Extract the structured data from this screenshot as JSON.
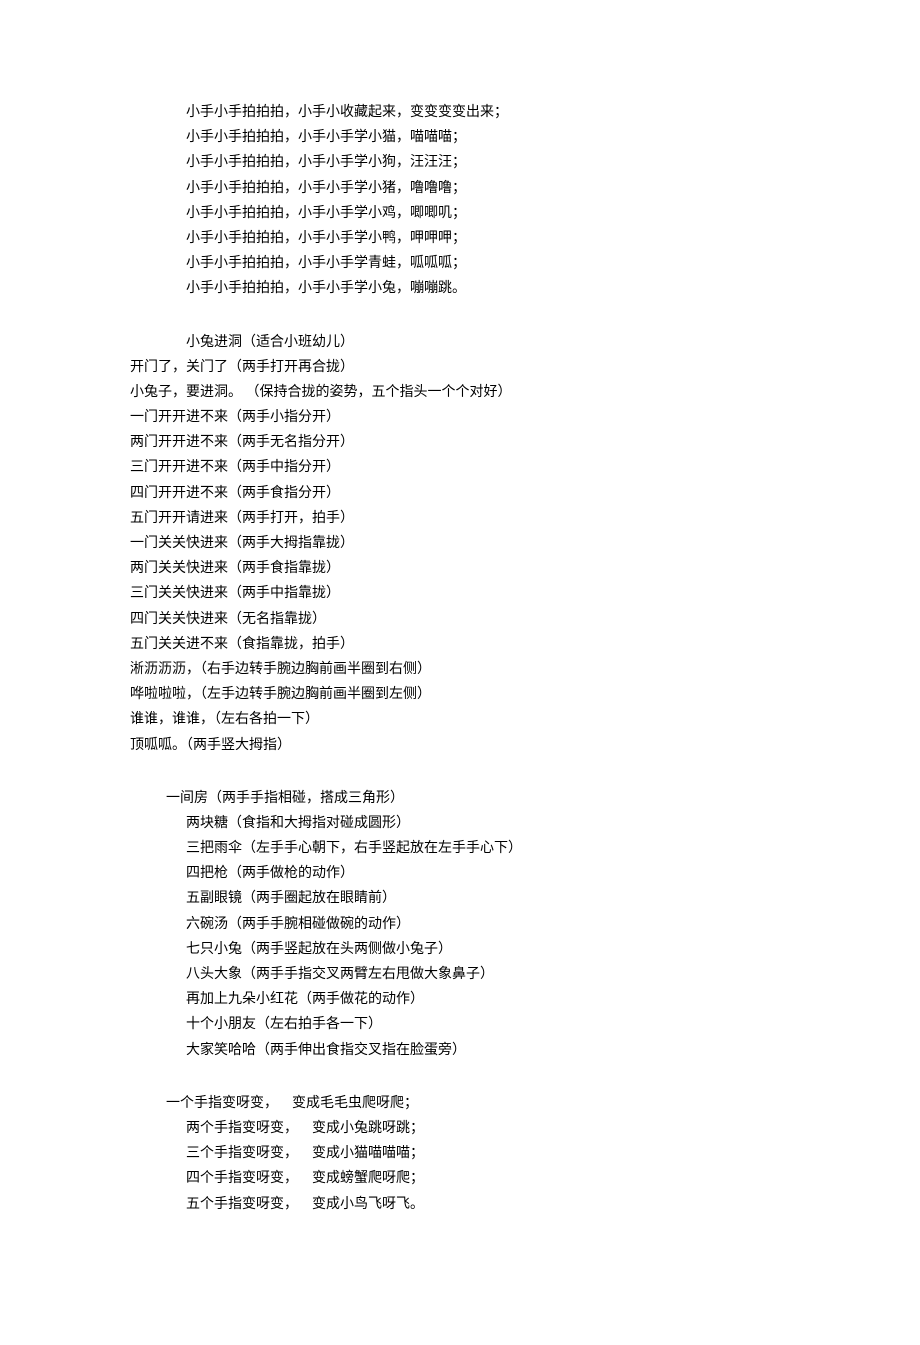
{
  "section1": {
    "lines": [
      "小手小手拍拍拍，小手小收藏起来，变变变变出来；",
      "小手小手拍拍拍，小手小手学小猫，喵喵喵；",
      "小手小手拍拍拍，小手小手学小狗，汪汪汪；",
      "小手小手拍拍拍，小手小手学小猪，噜噜噜；",
      "小手小手拍拍拍，小手小手学小鸡，唧唧叽；",
      "小手小手拍拍拍，小手小手学小鸭，呷呷呷；",
      "小手小手拍拍拍，小手小手学青蛙，呱呱呱；",
      "小手小手拍拍拍，小手小手学小兔，嘣嘣跳。"
    ]
  },
  "section2": {
    "title": "小兔进洞（适合小班幼儿）",
    "lines": [
      "开门了，关门了（两手打开再合拢）",
      "小兔子，要进洞。 （保持合拢的姿势，五个指头一个个对好）",
      "一门开开进不来（两手小指分开）",
      "两门开开进不来（两手无名指分开）",
      "三门开开进不来（两手中指分开）",
      "四门开开进不来（两手食指分开）",
      "五门开开请进来（两手打开，拍手）",
      "一门关关快进来（两手大拇指靠拢）",
      "两门关关快进来（两手食指靠拢）",
      "三门关关快进来（两手中指靠拢）",
      "四门关关快进来（无名指靠拢）",
      "五门关关进不来（食指靠拢，拍手）",
      "淅沥沥沥，（右手边转手腕边胸前画半圈到右侧）",
      "哗啦啦啦，（左手边转手腕边胸前画半圈到左侧）",
      "谁谁，谁谁，（左右各拍一下）",
      "顶呱呱。（两手竖大拇指）"
    ]
  },
  "section3": {
    "first": "一间房（两手手指相碰，搭成三角形）",
    "lines": [
      "两块糖（食指和大拇指对碰成圆形）",
      "三把雨伞（左手手心朝下，右手竖起放在左手手心下）",
      "四把枪（两手做枪的动作）",
      "五副眼镜（两手圈起放在眼睛前）",
      "六碗汤（两手手腕相碰做碗的动作）",
      "七只小兔（两手竖起放在头两侧做小兔子）",
      "八头大象（两手手指交叉两臂左右甩做大象鼻子）",
      "再加上九朵小红花（两手做花的动作）",
      "十个小朋友（左右拍手各一下）",
      "大家笑哈哈（两手伸出食指交叉指在脸蛋旁）"
    ]
  },
  "section4": {
    "lines": [
      "一个手指变呀变，    变成毛毛虫爬呀爬；",
      "两个手指变呀变，    变成小兔跳呀跳；",
      "三个手指变呀变，    变成小猫喵喵喵；",
      "四个手指变呀变，    变成螃蟹爬呀爬；",
      "五个手指变呀变，    变成小鸟飞呀飞。"
    ]
  }
}
